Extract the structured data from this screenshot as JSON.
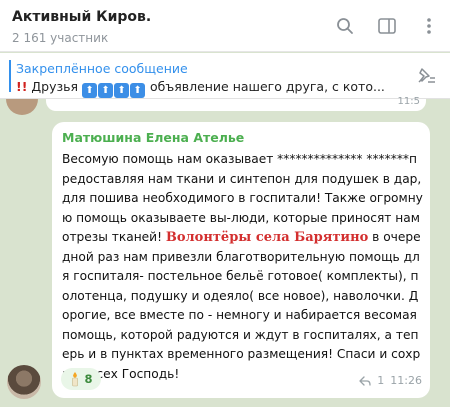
{
  "header": {
    "title": "Активный Киров.",
    "subtitle": "2 161 участник"
  },
  "pinned": {
    "title": "Закреплённое сообщение",
    "prefix": "Друзья",
    "text": "объявление нашего друга, с кото..."
  },
  "previous_message": {
    "time": "11:5"
  },
  "message": {
    "sender": "Матюшина Елена Ателье",
    "text_1": "Весомую помощь нам оказывает ************** *******предоставляя нам ткани и синтепон для подушек в дар, для пошива необходимого в госпитали! Также огромную помощь оказываете вы-люди, которые приносят нам отрезы тканей!",
    "highlight": "Волонтёры села Барятино",
    "text_2": "в очередной раз нам привезли благотворительную помощь для госпиталя- постельное бельё готовое( комплекты), полотенца, подушку и одеяло( все новое), наволочки. Дорогие, все вместе по - немногу и набирается весомая помощь, которой радуются и ждут в госпиталях, а теперь и в пунктах временного размещения! Спаси и сохрани всех Господь!",
    "reaction_count": "8",
    "reply_count": "1",
    "time": "11:26"
  },
  "colors": {
    "accent": "#3390ec",
    "sender": "#4caf50",
    "highlight": "#d32f2f",
    "background": "#d9e3cf"
  }
}
